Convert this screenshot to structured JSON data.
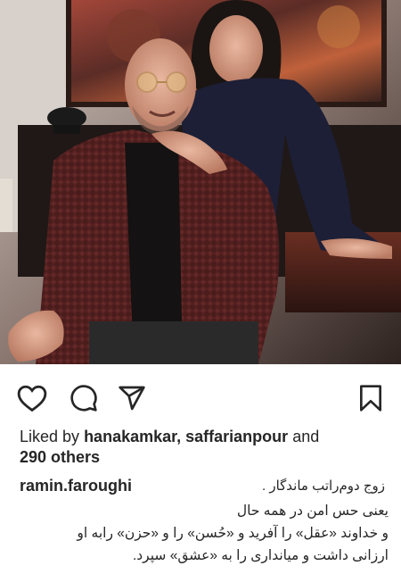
{
  "post": {
    "liked_by_prefix": "Liked by",
    "liked_by_users": "hanakamkar, saffarianpour",
    "liked_by_and": "and",
    "others_count": "290 others",
    "username": "ramin.faroughi",
    "caption_lines": [
      "زوج دوم‌راتب ماندگار .",
      "یعنی حس امن در همه حال",
      "و خداوند «عقل» را آفرید و «حُسن» را و «حزن» رابه او",
      "ارزانی داشت و میانداری را به «عشق» سپرد."
    ]
  },
  "icons": {
    "like": "heart-icon",
    "comment": "comment-icon",
    "share": "paper-plane-icon",
    "save": "bookmark-icon"
  }
}
